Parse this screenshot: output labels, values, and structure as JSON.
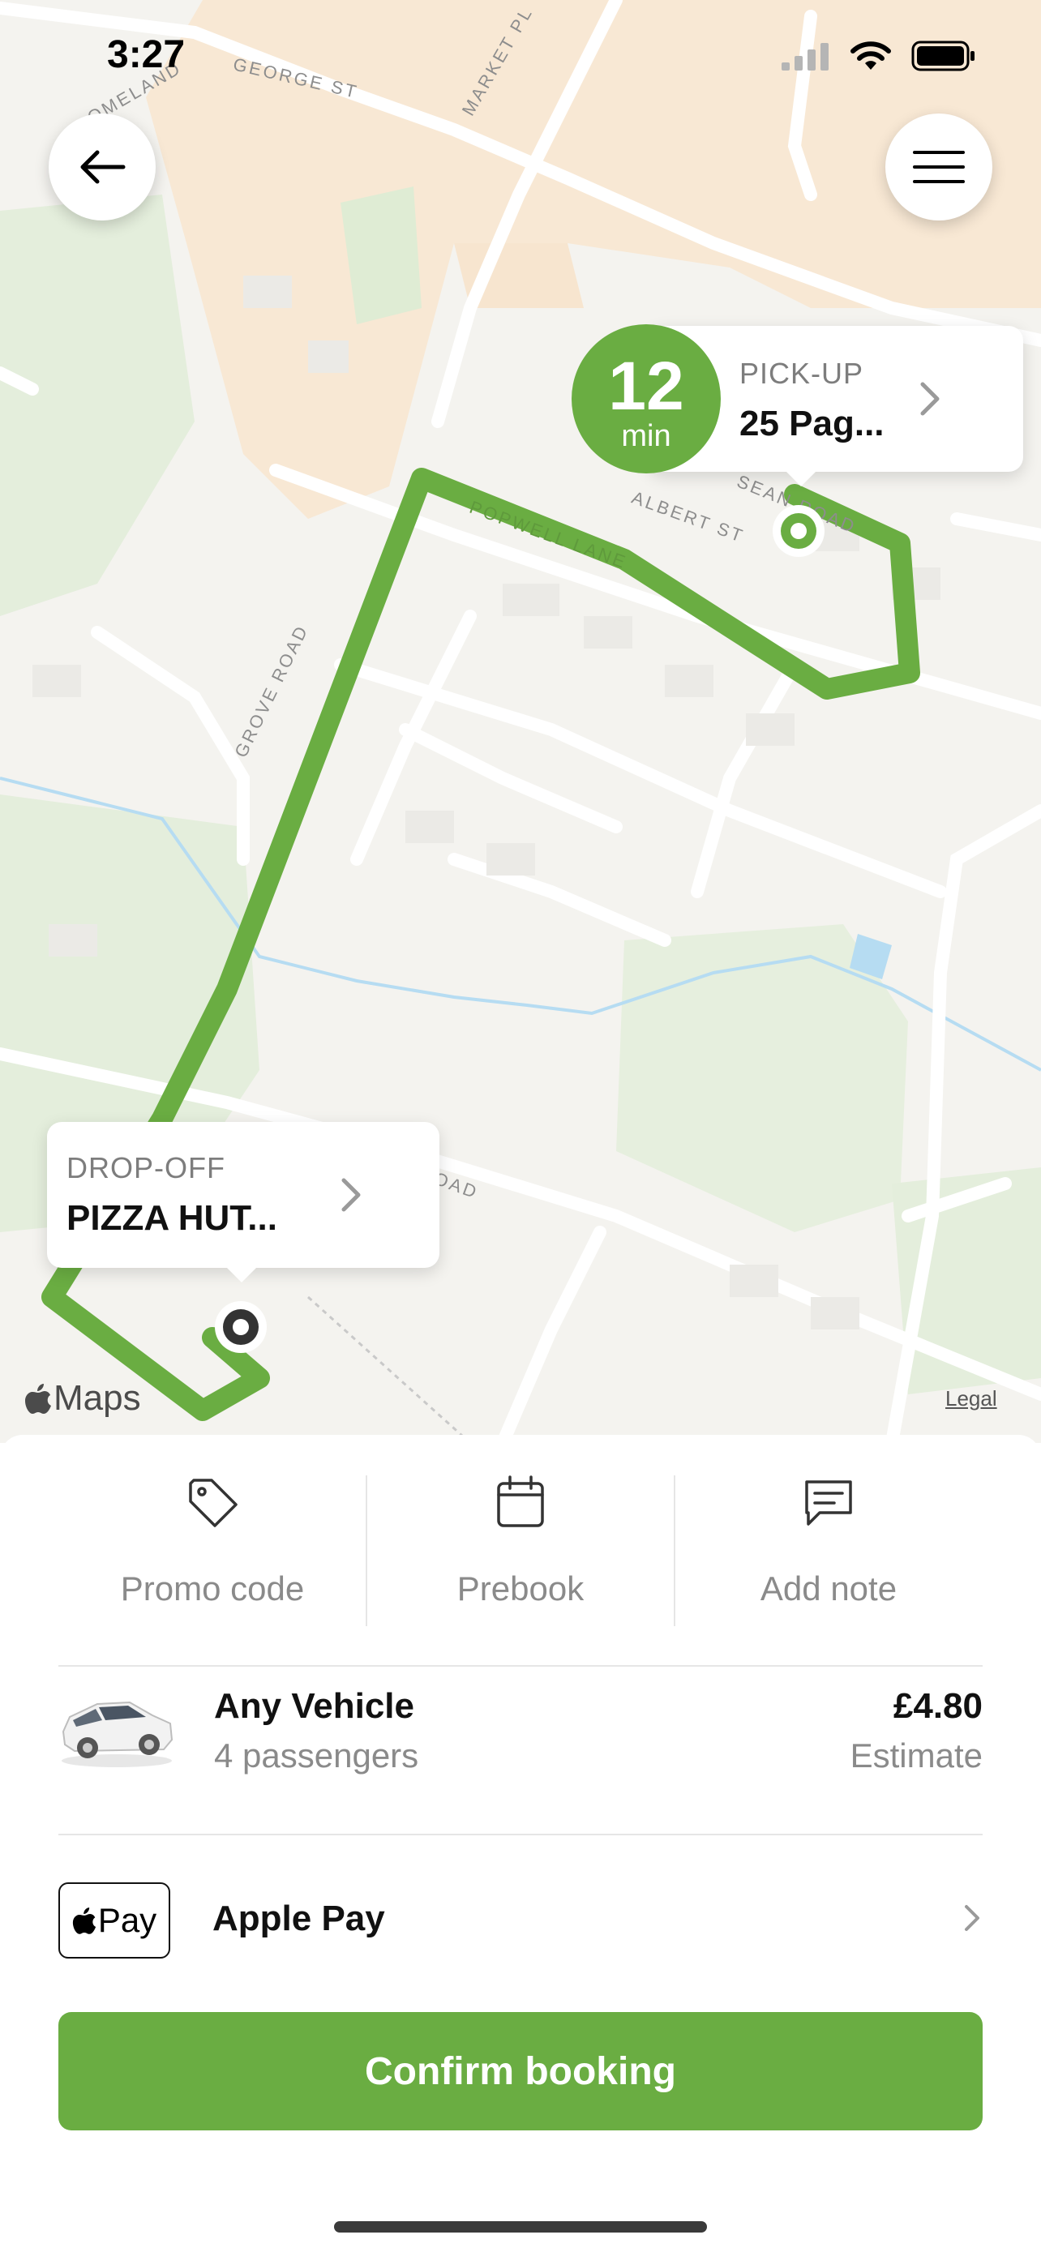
{
  "status_bar": {
    "time": "3:27"
  },
  "map": {
    "street_labels": [
      "GEORGE ST",
      "MARKET PL",
      "ALBERT ST",
      "GROVE ROAD",
      "POPWELL LANE",
      "SEAN ROAD",
      "OMELAND",
      "OAD"
    ],
    "pickup": {
      "eta_number": "12",
      "eta_unit": "min",
      "label": "PICK-UP",
      "value": "25 Pag..."
    },
    "dropoff": {
      "label": "DROP-OFF",
      "value": "PIZZA HUT..."
    },
    "maps_logo": "Maps",
    "legal": "Legal",
    "route_color": "#6aad42"
  },
  "actions": [
    {
      "label": "Promo code",
      "icon": "tag-icon"
    },
    {
      "label": "Prebook",
      "icon": "calendar-icon"
    },
    {
      "label": "Add note",
      "icon": "note-icon"
    }
  ],
  "vehicle": {
    "name": "Any Vehicle",
    "passengers": "4 passengers",
    "price": "£4.80",
    "price_note": "Estimate"
  },
  "payment": {
    "badge": "Pay",
    "label": "Apple Pay"
  },
  "confirm_label": "Confirm booking",
  "accent_color": "#6aad42"
}
